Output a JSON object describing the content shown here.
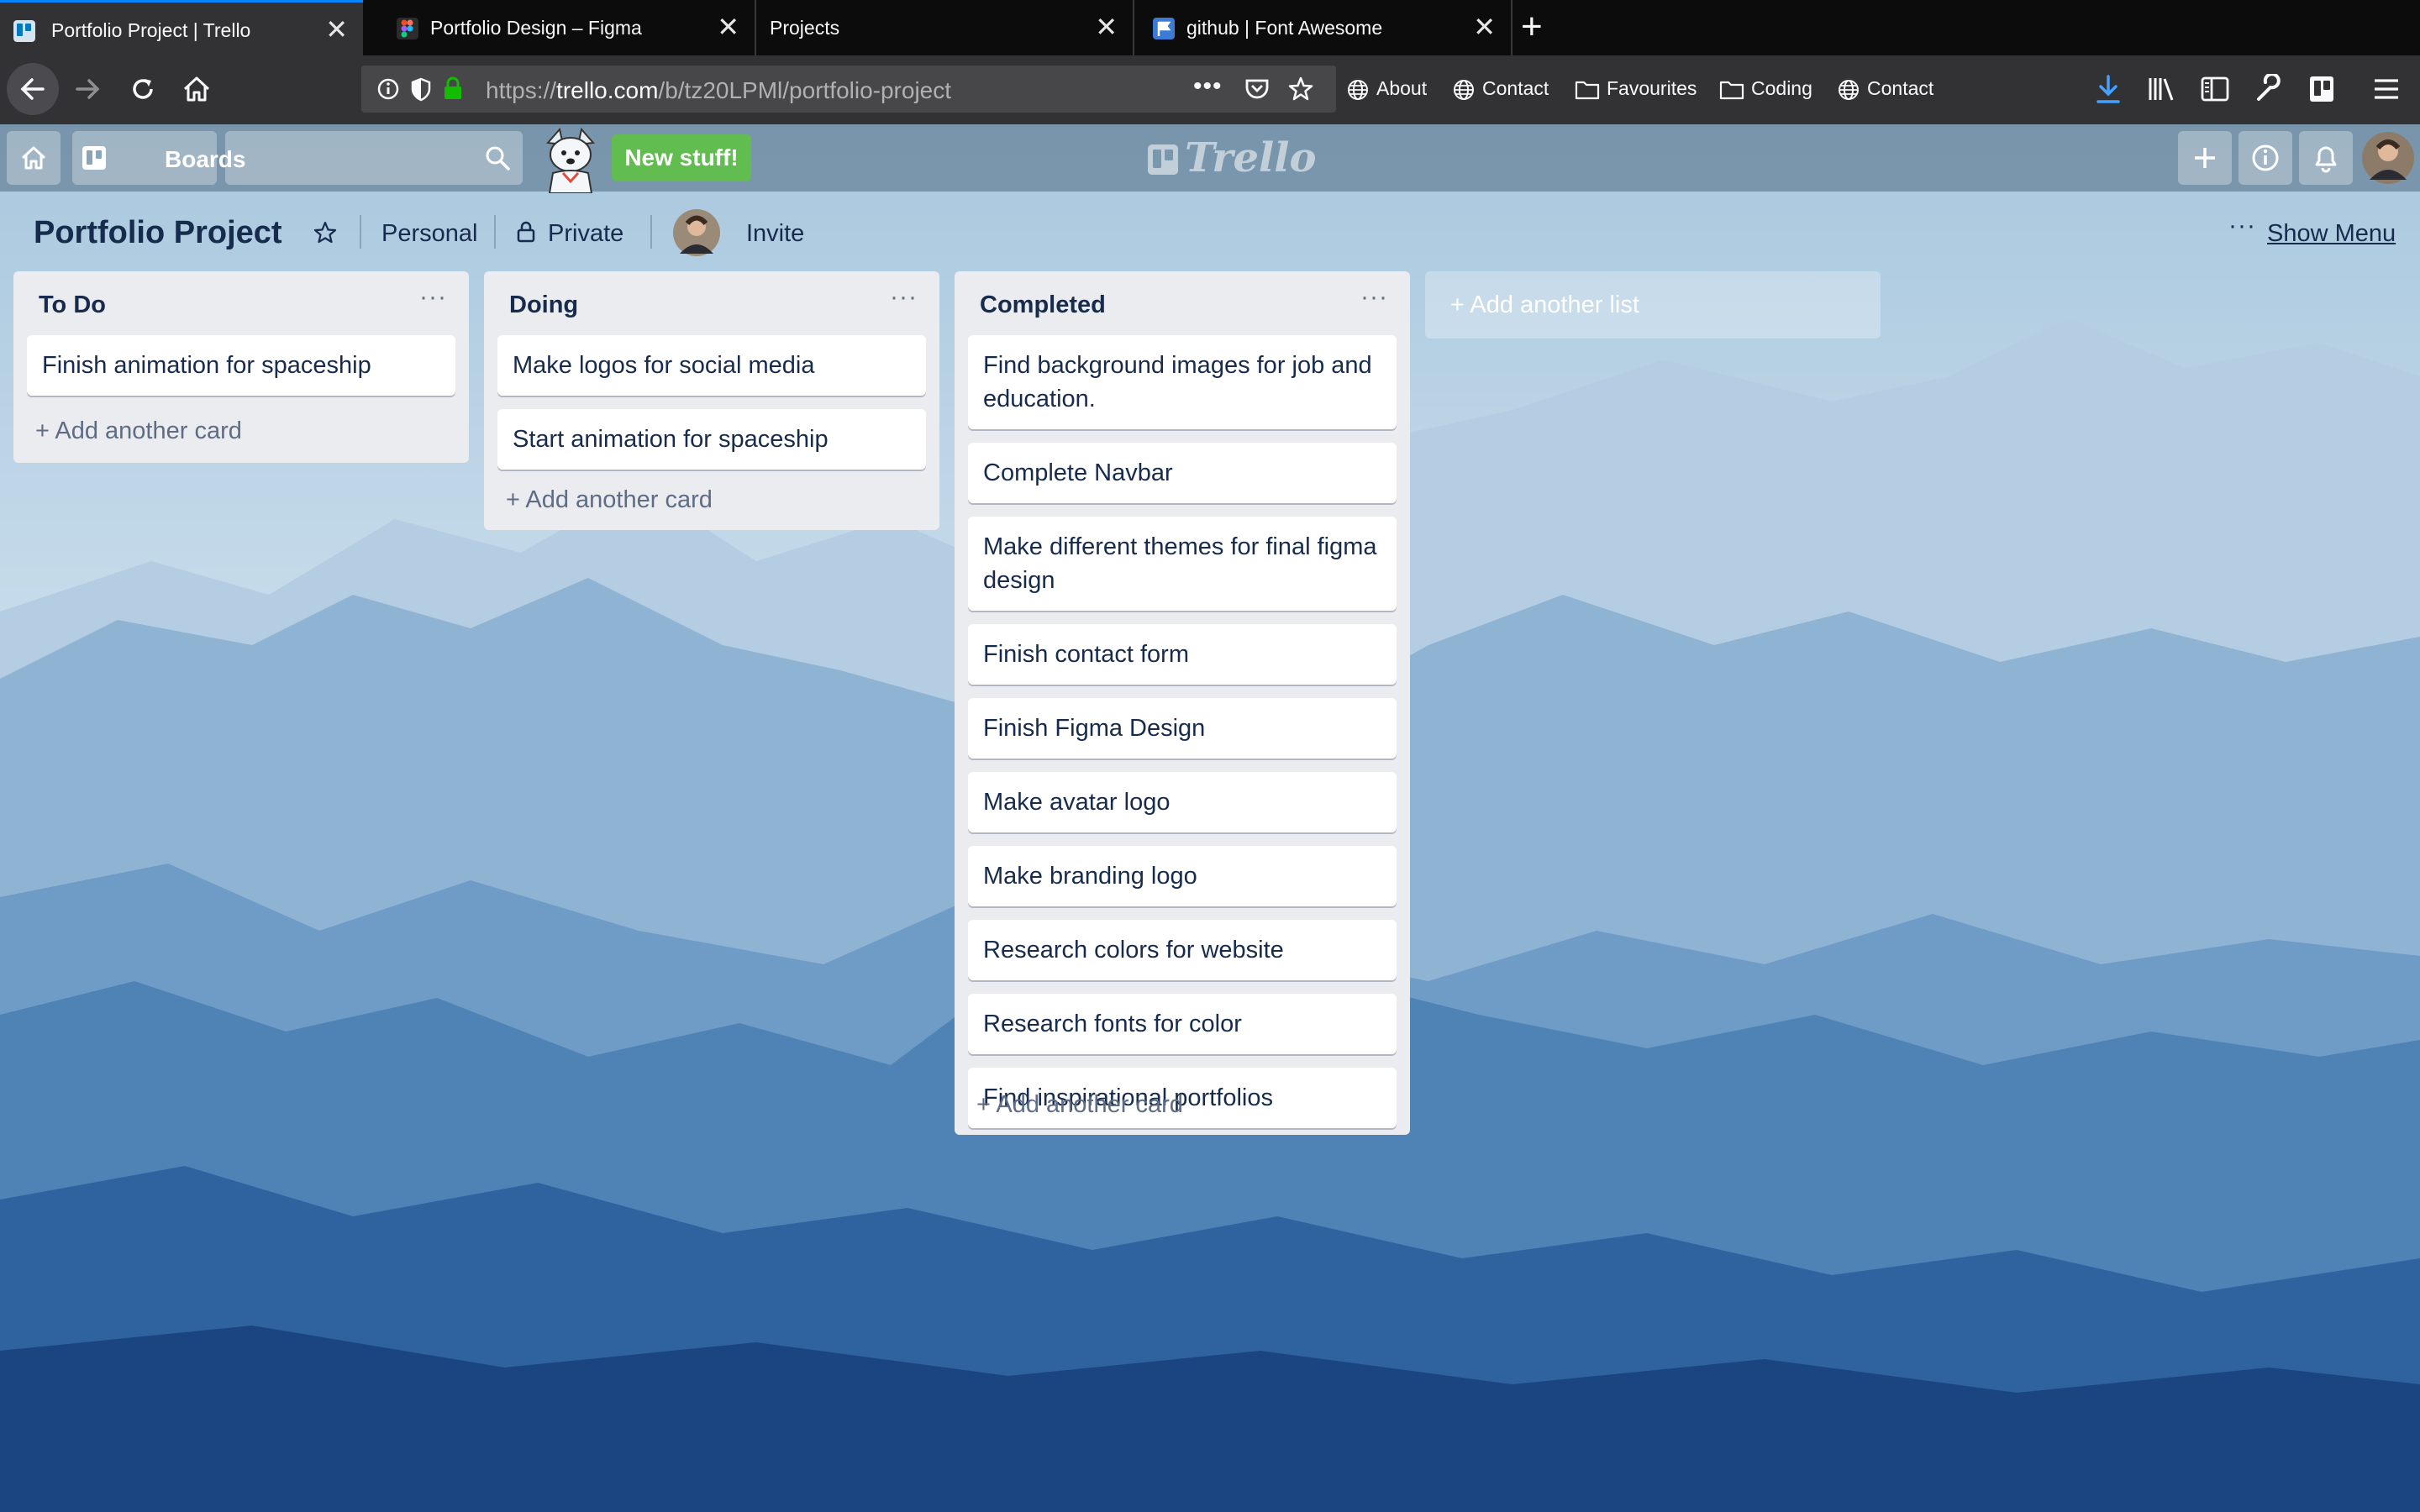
{
  "browser": {
    "tabs": [
      {
        "label": "Portfolio Project | Trello",
        "active": true,
        "favicon": "trello-icon"
      },
      {
        "label": "Portfolio Design – Figma",
        "active": false,
        "favicon": "figma-icon"
      },
      {
        "label": "Projects",
        "active": false,
        "favicon": ""
      },
      {
        "label": "github | Font Awesome",
        "active": false,
        "favicon": "font-awesome-icon"
      }
    ],
    "url_prefix": "https://",
    "url_host": "trello.com",
    "url_path": "/b/tz20LPMl/portfolio-project",
    "bookmarks": [
      {
        "label": "About",
        "icon": "globe-icon"
      },
      {
        "label": "Contact",
        "icon": "globe-icon"
      },
      {
        "label": "Favourites",
        "icon": "folder-icon"
      },
      {
        "label": "Coding",
        "icon": "folder-icon"
      },
      {
        "label": "Contact",
        "icon": "globe-icon"
      }
    ]
  },
  "trello_header": {
    "boards_label": "Boards",
    "new_stuff": "New stuff!",
    "logo": "Trello"
  },
  "board": {
    "title": "Portfolio Project",
    "team": "Personal",
    "visibility": "Private",
    "invite": "Invite",
    "show_menu": "Show Menu"
  },
  "lists": [
    {
      "title": "To Do",
      "cards": [
        "Finish animation for spaceship"
      ],
      "add_card": "+ Add another card"
    },
    {
      "title": "Doing",
      "cards": [
        "Make logos for social media",
        "Start animation for spaceship"
      ],
      "add_card": "+ Add another card"
    },
    {
      "title": "Completed",
      "cards": [
        "Find background images for job and education.",
        "Complete Navbar",
        "Make different themes for final figma design",
        "Finish contact form",
        "Finish Figma Design",
        "Make avatar logo",
        "Make branding logo",
        "Research colors for website",
        "Research fonts for color",
        "Find inspirational portfolios"
      ],
      "add_card": "+ Add another card"
    }
  ],
  "add_list": "+ Add another list",
  "colors": {
    "accent": "#0a84ff",
    "new_stuff": "#61bd4f",
    "list_bg": "#ebecf0",
    "text": "#172b4d"
  }
}
